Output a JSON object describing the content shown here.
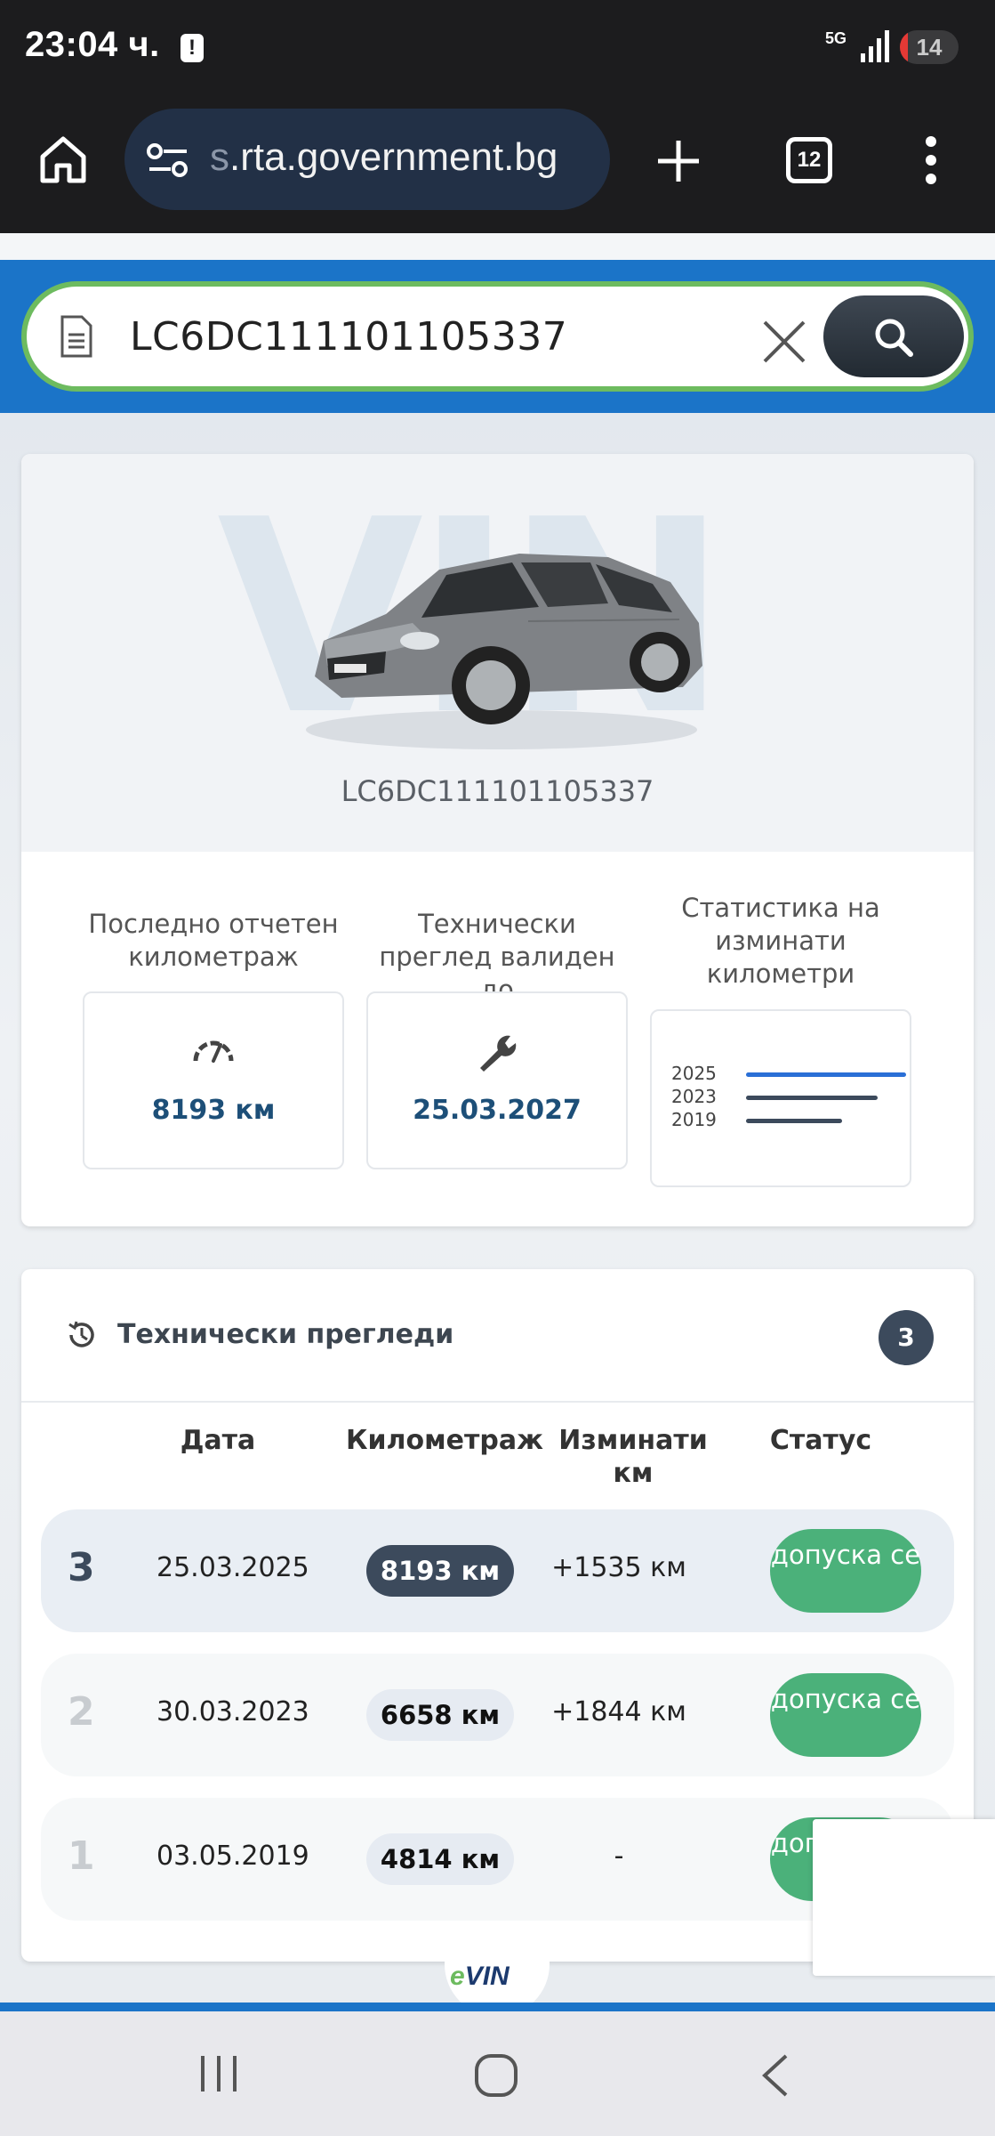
{
  "status_bar": {
    "time": "23:04 ч.",
    "alert_glyph": "!",
    "network": "5G",
    "battery": "14",
    "battery_level": 0.14
  },
  "browser": {
    "url_faded": "s",
    "url": ".rta.government.bg",
    "tab_count": "12",
    "icons": [
      "home-icon",
      "site-settings-icon",
      "new-tab-icon",
      "tab-switcher-icon",
      "overflow-menu-icon"
    ]
  },
  "search": {
    "value": "LC6DC111101105337",
    "colors": {
      "band": "#1b74c8",
      "border": "#6dbb5f"
    }
  },
  "vehicle": {
    "watermark": "VIN",
    "vin": "LC6DC111101105337"
  },
  "stats": {
    "mileage": {
      "title": "Последно отчетен километраж",
      "value": "8193 км"
    },
    "inspection": {
      "title": "Технически преглед валиден до",
      "value": "25.03.2027"
    },
    "chart": {
      "title": "Статистика на изминати километри",
      "rows": [
        {
          "year": "2025",
          "level": 1.0,
          "color": "#2a6fd6"
        },
        {
          "year": "2023",
          "level": 0.82,
          "color": "#3c4a5c"
        },
        {
          "year": "2019",
          "level": 0.6,
          "color": "#3c4a5c"
        }
      ]
    }
  },
  "inspections": {
    "title": "Технически прегледи",
    "count": "3",
    "columns": {
      "date": "Дата",
      "mileage": "Километраж",
      "diff": "Изминати км",
      "status": "Статус"
    },
    "rows": [
      {
        "num": "3",
        "date": "25.03.2025",
        "km": "8193 км",
        "diff": "+1535 км",
        "status": "допуска се",
        "highlight": true
      },
      {
        "num": "2",
        "date": "30.03.2023",
        "km": "6658 км",
        "diff": "+1844 км",
        "status": "допуска се",
        "highlight": false
      },
      {
        "num": "1",
        "date": "03.05.2019",
        "km": "4814 км",
        "diff": "-",
        "status": "допуска се",
        "highlight": false
      }
    ]
  },
  "footer": {
    "logo_e": "e",
    "logo_vin": "VIN"
  }
}
